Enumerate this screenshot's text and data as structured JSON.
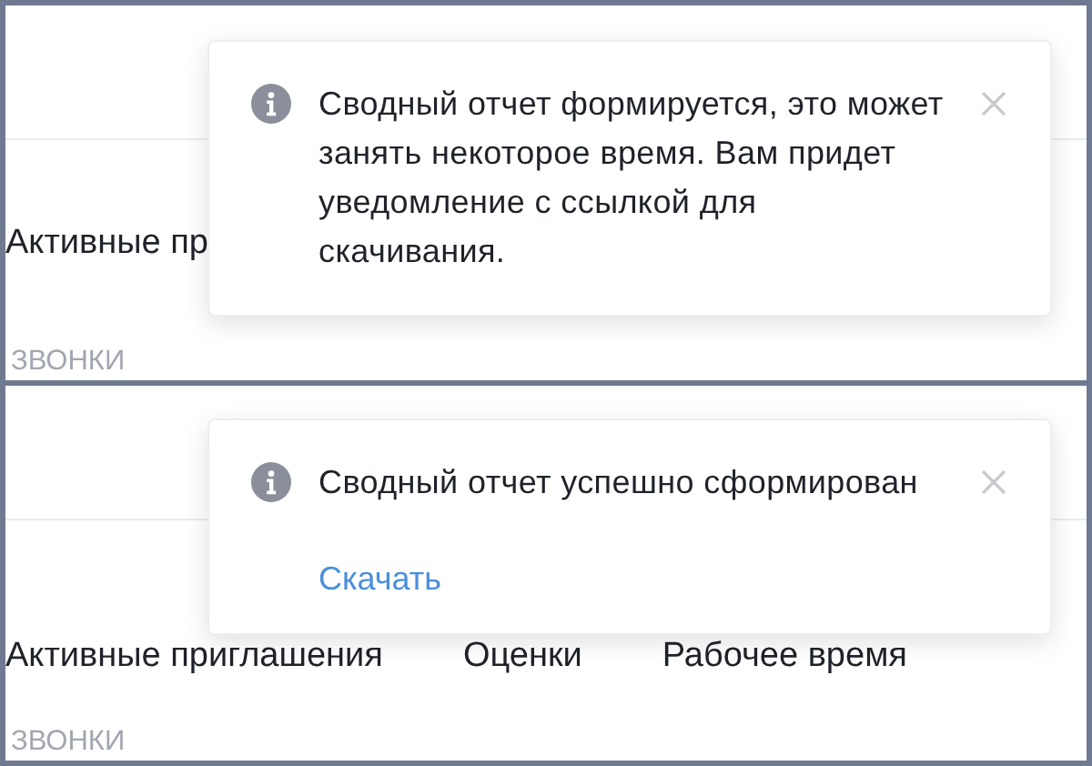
{
  "panels": [
    {
      "background": {
        "tabs": [
          {
            "label": "Активные пр"
          }
        ],
        "section_label": "ЗВОНКИ"
      },
      "toast": {
        "message": "Сводный отчет формируется, это может занять некоторое время. Вам придет уведомление с ссылкой для скачивания."
      }
    },
    {
      "background": {
        "tabs": [
          {
            "label": "Активные приглашения"
          },
          {
            "label": "Оценки"
          },
          {
            "label": "Рабочее время"
          }
        ],
        "section_label": "ЗВОНКИ"
      },
      "toast": {
        "message": "Сводный отчет успешно сформирован",
        "link": "Скачать"
      }
    }
  ]
}
